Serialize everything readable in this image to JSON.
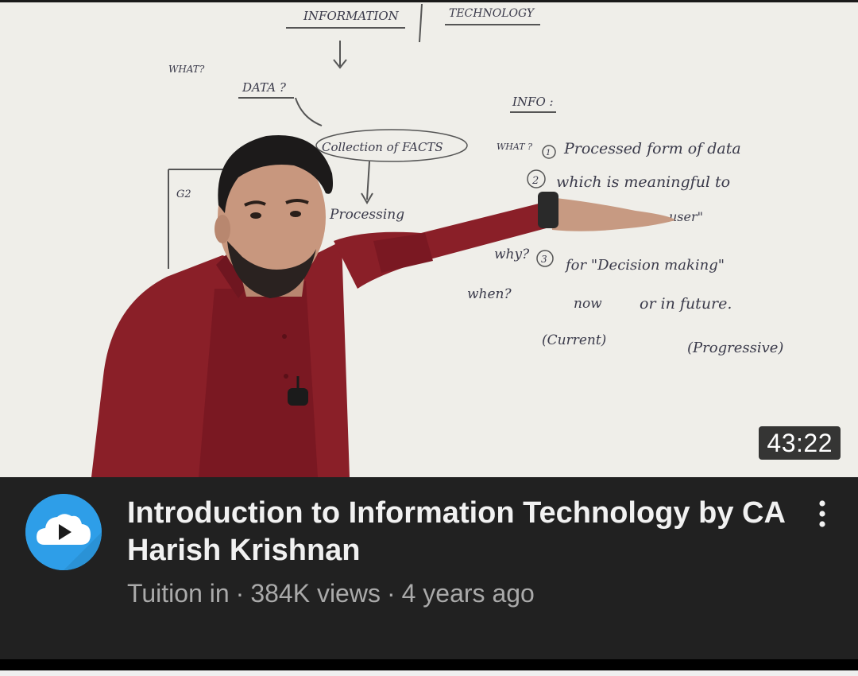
{
  "video": {
    "duration": "43:22",
    "title": "Introduction to Information Technology by CA Harish Krishnan",
    "channel": "Tuition in",
    "views": "384K views",
    "age": "4 years ago",
    "separator": "·"
  },
  "avatar": {
    "icon": "cloud-play-icon",
    "color": "#2e9ee8"
  },
  "menu": {
    "icon": "more-vert-icon"
  },
  "whiteboard": {
    "heading_left": "INFORMATION",
    "heading_right": "TECHNOLOGY",
    "what": "WHAT?",
    "data": "DATA ?",
    "collection": "Collection of FACTS",
    "processing": "Processing",
    "g2": "G2",
    "info": "INFO :",
    "what_info": "WHAT ?",
    "processed": "Processed form of data",
    "meaningful": "which is meaningful to",
    "num_1": "1",
    "num_2": "2",
    "num_3": "3",
    "user_word": "user\"",
    "why": "why?",
    "decision": "for \"Decision making\"",
    "when": "when?",
    "now": "now",
    "or_in_future": "or in future.",
    "current": "(Current)",
    "progressive": "(Progressive)"
  }
}
